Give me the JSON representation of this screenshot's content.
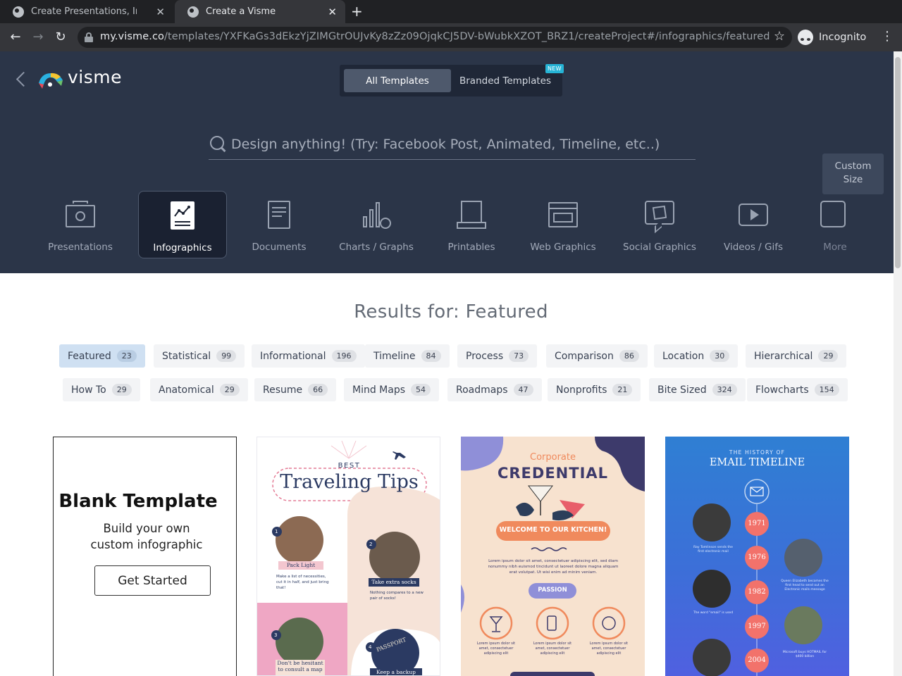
{
  "browser": {
    "tabs": [
      {
        "title": "Create Presentations, Infog",
        "active": false
      },
      {
        "title": "Create a Visme",
        "active": true
      }
    ],
    "new_tab": "+",
    "url_host": "my.visme.co",
    "url_path": "/templates/YXFKaGs3dEkzYjZIMGtrOUJvKy8zZz09OjqkCJ5DV-bWubkXZOT_BRZ1/createProject#/infographics/featured",
    "profile": "Incognito"
  },
  "header": {
    "logo_text": "visme",
    "switcher": {
      "all": "All Templates",
      "branded": "Branded Templates",
      "badge": "NEW"
    },
    "search_placeholder": "Design anything! (Try: Facebook Post, Animated, Timeline, etc..)",
    "categories": [
      {
        "label": "Presentations",
        "active": false
      },
      {
        "label": "Infographics",
        "active": true
      },
      {
        "label": "Documents",
        "active": false
      },
      {
        "label": "Charts / Graphs",
        "active": false
      },
      {
        "label": "Printables",
        "active": false
      },
      {
        "label": "Web Graphics",
        "active": false
      },
      {
        "label": "Social Graphics",
        "active": false
      },
      {
        "label": "Videos / Gifs",
        "active": false
      },
      {
        "label": "More",
        "active": false
      }
    ],
    "custom_size_line1": "Custom",
    "custom_size_line2": "Size"
  },
  "results": {
    "title": "Results for: Featured",
    "filters": [
      {
        "label": "Featured",
        "count": "23",
        "active": true
      },
      {
        "label": "Statistical",
        "count": "99"
      },
      {
        "label": "Informational",
        "count": "196"
      },
      {
        "label": "Timeline",
        "count": "84"
      },
      {
        "label": "Process",
        "count": "73"
      },
      {
        "label": "Comparison",
        "count": "86"
      },
      {
        "label": "Location",
        "count": "30"
      },
      {
        "label": "Hierarchical",
        "count": "29"
      },
      {
        "label": "How To",
        "count": "29"
      },
      {
        "label": "Anatomical",
        "count": "29"
      },
      {
        "label": "Resume",
        "count": "66"
      },
      {
        "label": "Mind Maps",
        "count": "54"
      },
      {
        "label": "Roadmaps",
        "count": "47"
      },
      {
        "label": "Nonprofits",
        "count": "21"
      },
      {
        "label": "Bite Sized",
        "count": "324"
      },
      {
        "label": "Flowcharts",
        "count": "154"
      }
    ]
  },
  "blank": {
    "title": "Blank Template",
    "subtitle_line1": "Build your own",
    "subtitle_line2": "custom infographic",
    "button": "Get Started"
  },
  "template_travel": {
    "kicker": "BEST",
    "title": "Traveling Tips",
    "step1_num": "1",
    "step1_label": "Pack Light",
    "step1_text": "Make a list of necessities, cut it in half, and just bring that!",
    "step2_num": "2",
    "step2_label": "Take extra socks",
    "step2_text": "Nothing compares to a new pair of socks!",
    "step3_num": "3",
    "step3_label": "Don't be hesitant to consult a map",
    "step4_num": "4",
    "step4_label": "Keep a backup copy",
    "passport": "PASSPORT"
  },
  "template_credential": {
    "kicker": "Corporate",
    "title": "CREDENTIAL",
    "banner": "WELCOME TO OUR KITCHEN!",
    "body": "Lorem ipsum dolor sit amet, consectetuer adipiscing elit, sed diam nonummy nibh euismod tincidunt ut laoreet dolore magna aliquam erat volutpat. Ut wisi enim ad minim veniam.",
    "pill": "PASSION",
    "col_text": "Lorem ipsum dolor sit amet, consectetuer adipiscing elit"
  },
  "template_email": {
    "kicker": "THE HISTORY OF",
    "title": "EMAIL TIMELINE",
    "years": [
      "1971",
      "1976",
      "1982",
      "1997",
      "2004"
    ],
    "note1": "Ray Tomlinson sends the first electronic mail",
    "note2": "Queen Elizabeth becomes the first head to send out an Electronic mails message",
    "note3": "The word \"email\" is used",
    "note4": "Microsoft buys HOTMAIL for $400 billion"
  },
  "colors": {
    "header_bg": "#2b3548",
    "chip_active": "#cfe0f2",
    "accent_orange": "#f08a5d",
    "timeline_circle": "#f2726b"
  }
}
